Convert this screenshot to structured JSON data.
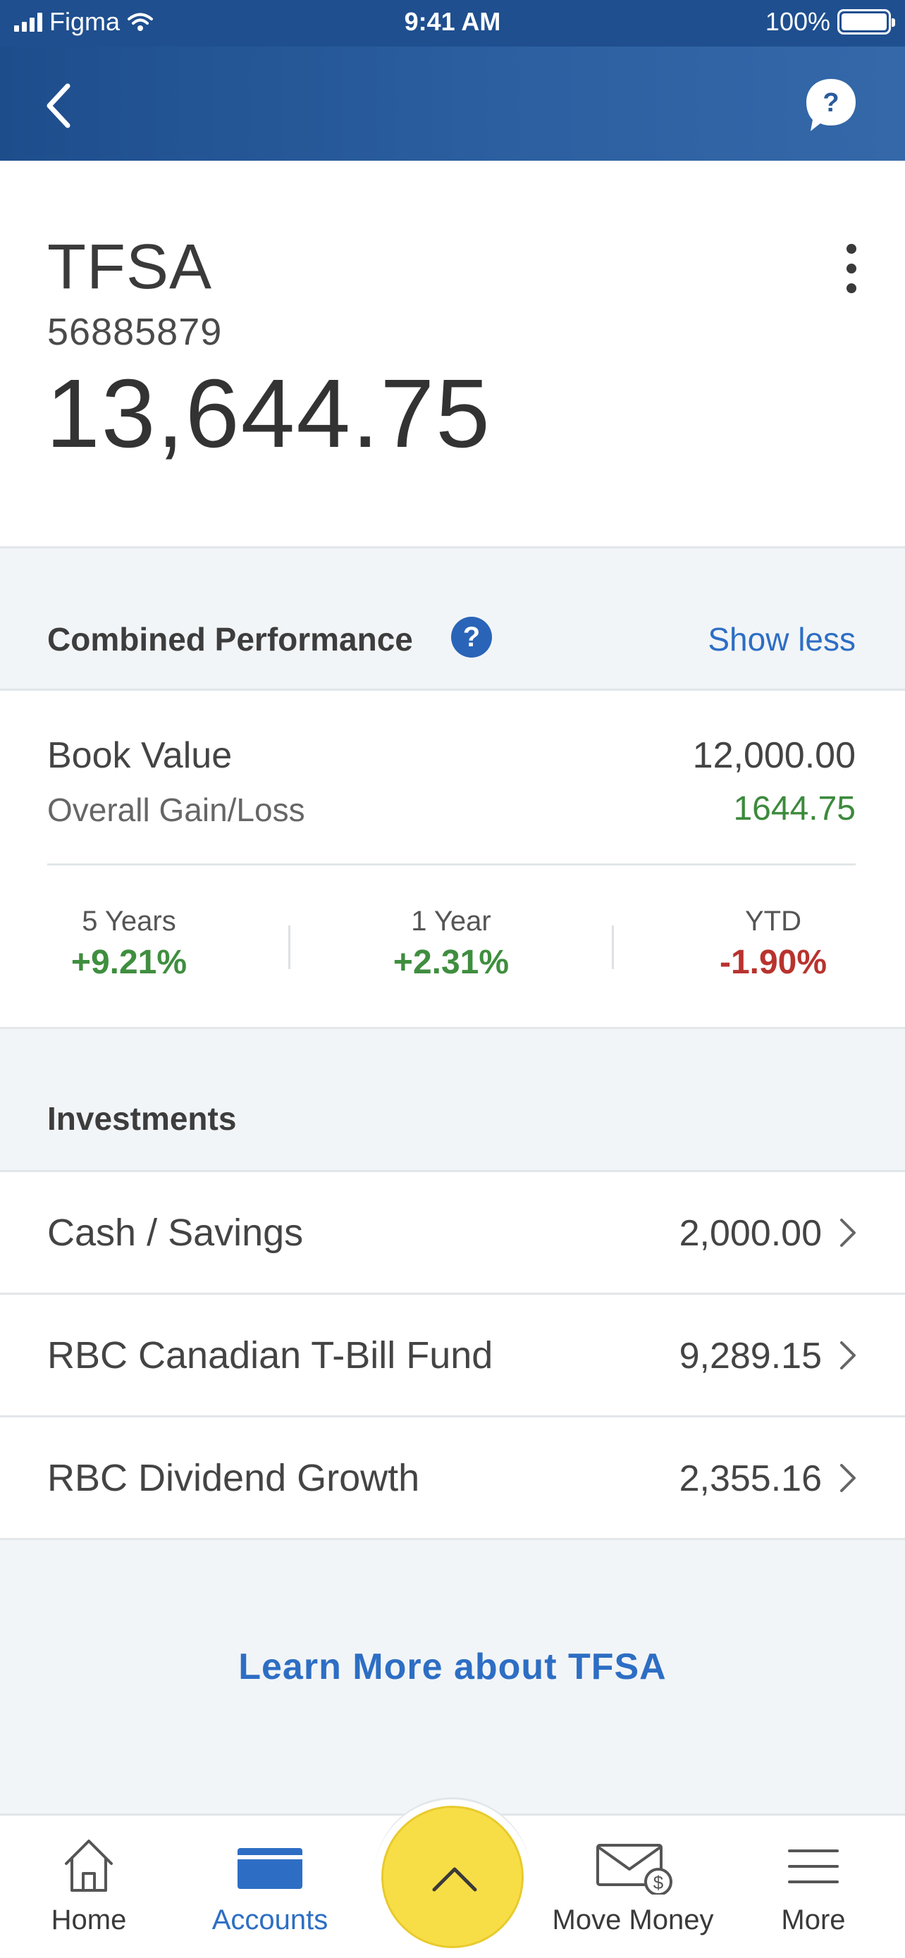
{
  "status_bar": {
    "carrier": "Figma",
    "time": "9:41 AM",
    "battery": "100%"
  },
  "header": {
    "back_icon": "chevron-left-icon",
    "help_icon": "chat-help-icon"
  },
  "account": {
    "name": "TFSA",
    "number": "56885879",
    "balance": "13,644.75"
  },
  "performance": {
    "title": "Combined Performance",
    "help_glyph": "?",
    "toggle_label": "Show less",
    "book_value_label": "Book Value",
    "book_value": "12,000.00",
    "gain_loss_label": "Overall Gain/Loss",
    "gain_loss": "1644.75",
    "periods": [
      {
        "label": "5 Years",
        "value": "+9.21%"
      },
      {
        "label": "1 Year",
        "value": "+2.31%"
      },
      {
        "label": "YTD",
        "value": "-1.90%"
      }
    ],
    "colors": {
      "positive": "#3f8e3f",
      "negative": "#b8332e"
    }
  },
  "investments": {
    "title": "Investments",
    "items": [
      {
        "name": "Cash / Savings",
        "amount": "2,000.00"
      },
      {
        "name": "RBC Canadian T-Bill Fund",
        "amount": "9,289.15"
      },
      {
        "name": "RBC Dividend Growth",
        "amount": "2,355.16"
      }
    ]
  },
  "learn_more": "Learn More about TFSA",
  "tab_bar": {
    "tabs": [
      {
        "label": "Home",
        "icon": "home-icon"
      },
      {
        "label": "Accounts",
        "icon": "card-icon",
        "active": true
      },
      {
        "label": "Move Money",
        "icon": "envelope-dollar-icon"
      },
      {
        "label": "More",
        "icon": "menu-icon"
      }
    ],
    "fab_icon": "chevron-up-icon"
  },
  "theme": {
    "header_blue": "#1f4f8f",
    "link_blue": "#2d6ec4",
    "fab_yellow": "#f8de46"
  }
}
